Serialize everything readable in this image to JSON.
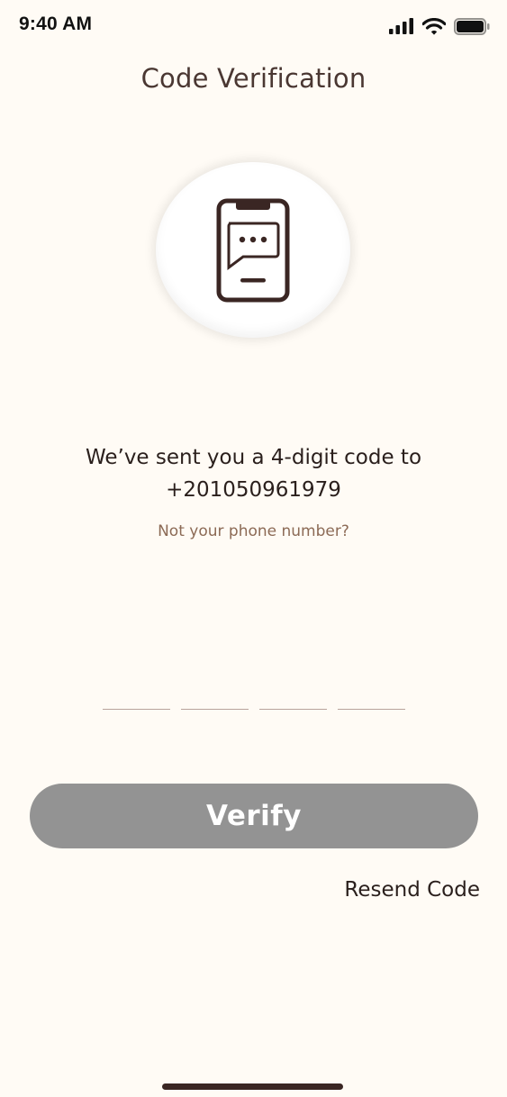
{
  "status_bar": {
    "time": "9:40 AM",
    "icons": [
      "cellular-signal-icon",
      "wifi-icon",
      "battery-icon"
    ]
  },
  "header": {
    "title": "Code Verification"
  },
  "illustration": {
    "icon": "phone-message-icon"
  },
  "message": {
    "line1": "We’ve sent you a 4-digit code to",
    "phone": "+201050961979"
  },
  "change_number_link": "Not your phone number?",
  "otp": {
    "digits": [
      "",
      "",
      "",
      ""
    ]
  },
  "verify_button": {
    "label": "Verify"
  },
  "resend_link": "Resend Code",
  "colors": {
    "background": "#FFFBF5",
    "primary_text": "#2A1F1C",
    "title_text": "#4A3732",
    "link_text": "#8C6A55",
    "button_disabled": "#939393",
    "icon_brown": "#3A2623"
  }
}
